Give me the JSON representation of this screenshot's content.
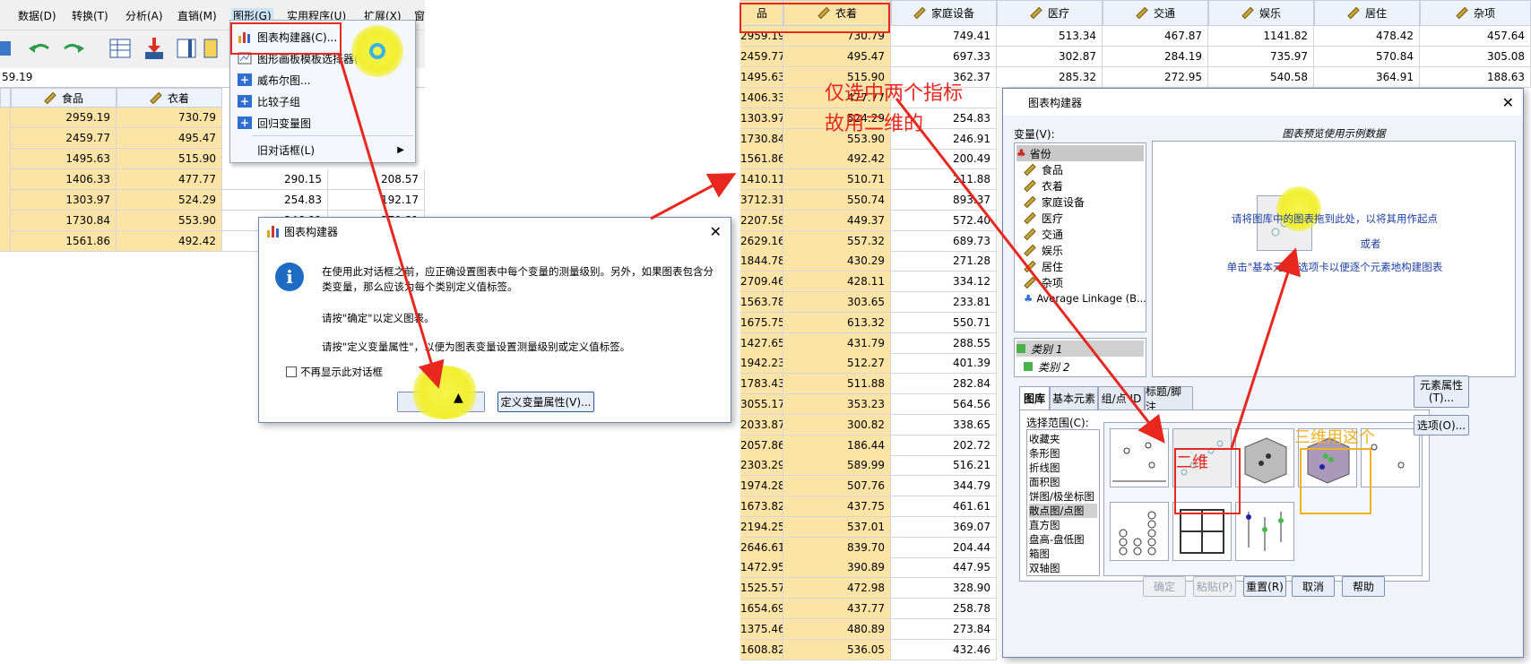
{
  "menubar": {
    "items": [
      "数据(D)",
      "转换(T)",
      "分析(A)",
      "直销(M)",
      "图形(G)",
      "实用程序(U)",
      "扩展(X)",
      "窗"
    ]
  },
  "cell_ref": "59.19",
  "left_grid": {
    "headers": [
      "食品",
      "衣着"
    ],
    "rows": [
      [
        "2959.19",
        "730.79",
        "",
        "34"
      ],
      [
        "2459.77",
        "495.47",
        "",
        "87"
      ],
      [
        "1495.63",
        "515.90",
        "",
        "32"
      ],
      [
        "1406.33",
        "477.77",
        "290.15",
        "208.57"
      ],
      [
        "1303.97",
        "524.29",
        "254.83",
        "192.17"
      ],
      [
        "1730.84",
        "553.90",
        "246.91",
        "279.81"
      ],
      [
        "1561.86",
        "492.42",
        "",
        ""
      ]
    ]
  },
  "graph_menu": {
    "items": [
      "图表构建器(C)...",
      "图形画板模板选择器(G)...",
      "威布尔图...",
      "比较子组",
      "回归变量图",
      "旧对话框(L)"
    ]
  },
  "info_dialog": {
    "title": "图表构建器",
    "message1": "在使用此对话框之前，应正确设置图表中每个变量的测量级别。另外，如果图表包含分类变量，那么应该为每个类别定义值标签。",
    "message2": "请按\"确定\"以定义图表。",
    "message3": "请按\"定义变量属性\"，以便为图表变量设置测量级别或定义值标签。",
    "checkbox_label": "不再显示此对话框",
    "ok_label": "确定",
    "define_label": "定义变量属性(V)..."
  },
  "right_grid": {
    "headers": [
      "品",
      "衣着",
      "家庭设备",
      "医疗",
      "交通",
      "娱乐",
      "居住",
      "杂项"
    ],
    "top_rows": [
      [
        "2959.19",
        "730.79",
        "749.41",
        "513.34",
        "467.87",
        "1141.82",
        "478.42",
        "457.64"
      ],
      [
        "2459.77",
        "495.47",
        "697.33",
        "302.87",
        "284.19",
        "735.97",
        "570.84",
        "305.08"
      ],
      [
        "1495.63",
        "515.90",
        "362.37",
        "285.32",
        "272.95",
        "540.58",
        "364.91",
        "188.63"
      ]
    ],
    "side_rows": [
      [
        "1406.33",
        "477.77",
        ""
      ],
      [
        "1303.97",
        "524.29",
        "254.83"
      ],
      [
        "1730.84",
        "553.90",
        "246.91"
      ],
      [
        "1561.86",
        "492.42",
        "200.49"
      ],
      [
        "1410.11",
        "510.71",
        "211.88"
      ],
      [
        "3712.31",
        "550.74",
        "893.37"
      ],
      [
        "2207.58",
        "449.37",
        "572.40"
      ],
      [
        "2629.16",
        "557.32",
        "689.73"
      ],
      [
        "1844.78",
        "430.29",
        "271.28"
      ],
      [
        "2709.46",
        "428.11",
        "334.12"
      ],
      [
        "1563.78",
        "303.65",
        "233.81"
      ],
      [
        "1675.75",
        "613.32",
        "550.71"
      ],
      [
        "1427.65",
        "431.79",
        "288.55"
      ],
      [
        "1942.23",
        "512.27",
        "401.39"
      ],
      [
        "1783.43",
        "511.88",
        "282.84"
      ],
      [
        "3055.17",
        "353.23",
        "564.56"
      ],
      [
        "2033.87",
        "300.82",
        "338.65"
      ],
      [
        "2057.86",
        "186.44",
        "202.72"
      ],
      [
        "2303.29",
        "589.99",
        "516.21"
      ],
      [
        "1974.28",
        "507.76",
        "344.79"
      ],
      [
        "1673.82",
        "437.75",
        "461.61"
      ],
      [
        "2194.25",
        "537.01",
        "369.07"
      ],
      [
        "2646.61",
        "839.70",
        "204.44"
      ],
      [
        "1472.95",
        "390.89",
        "447.95"
      ],
      [
        "1525.57",
        "472.98",
        "328.90"
      ],
      [
        "1654.69",
        "437.77",
        "258.78"
      ],
      [
        "1375.46",
        "480.89",
        "273.84"
      ],
      [
        "1608.82",
        "536.05",
        "432.46"
      ]
    ]
  },
  "chart_builder": {
    "title": "图表构建器",
    "variables_label": "变量(V):",
    "preview_caption": "图表预览使用示例数据",
    "variables": [
      "省份",
      "食品",
      "衣着",
      "家庭设备",
      "医疗",
      "交通",
      "娱乐",
      "居住",
      "杂项",
      "Average Linkage (B..."
    ],
    "categories": [
      "类别 1",
      "类别 2"
    ],
    "drop_text1": "请将图库中的图表拖到此处，以将其用作起点",
    "drop_or": "或者",
    "drop_text2": "单击\"基本元素\"选项卡以便逐个元素地构建图表",
    "tabs": [
      "图库",
      "基本元素",
      "组/点 ID",
      "标题/脚注"
    ],
    "choose_from": "选择范围(C):",
    "chart_types": [
      "收藏夹",
      "条形图",
      "折线图",
      "面积图",
      "饼图/极坐标图",
      "散点图/点图",
      "直方图",
      "盘高-盘低图",
      "箱图",
      "双轴图"
    ],
    "element_props": "元素属性(T)...",
    "options": "选项(O)...",
    "buttons": [
      "确定",
      "粘贴(P)",
      "重置(R)",
      "取消",
      "帮助"
    ]
  },
  "annotations": {
    "note1": "仅选中两个指标",
    "note2": "故用二维的",
    "label_2d": "二维",
    "label_3d": "三维用这个"
  }
}
